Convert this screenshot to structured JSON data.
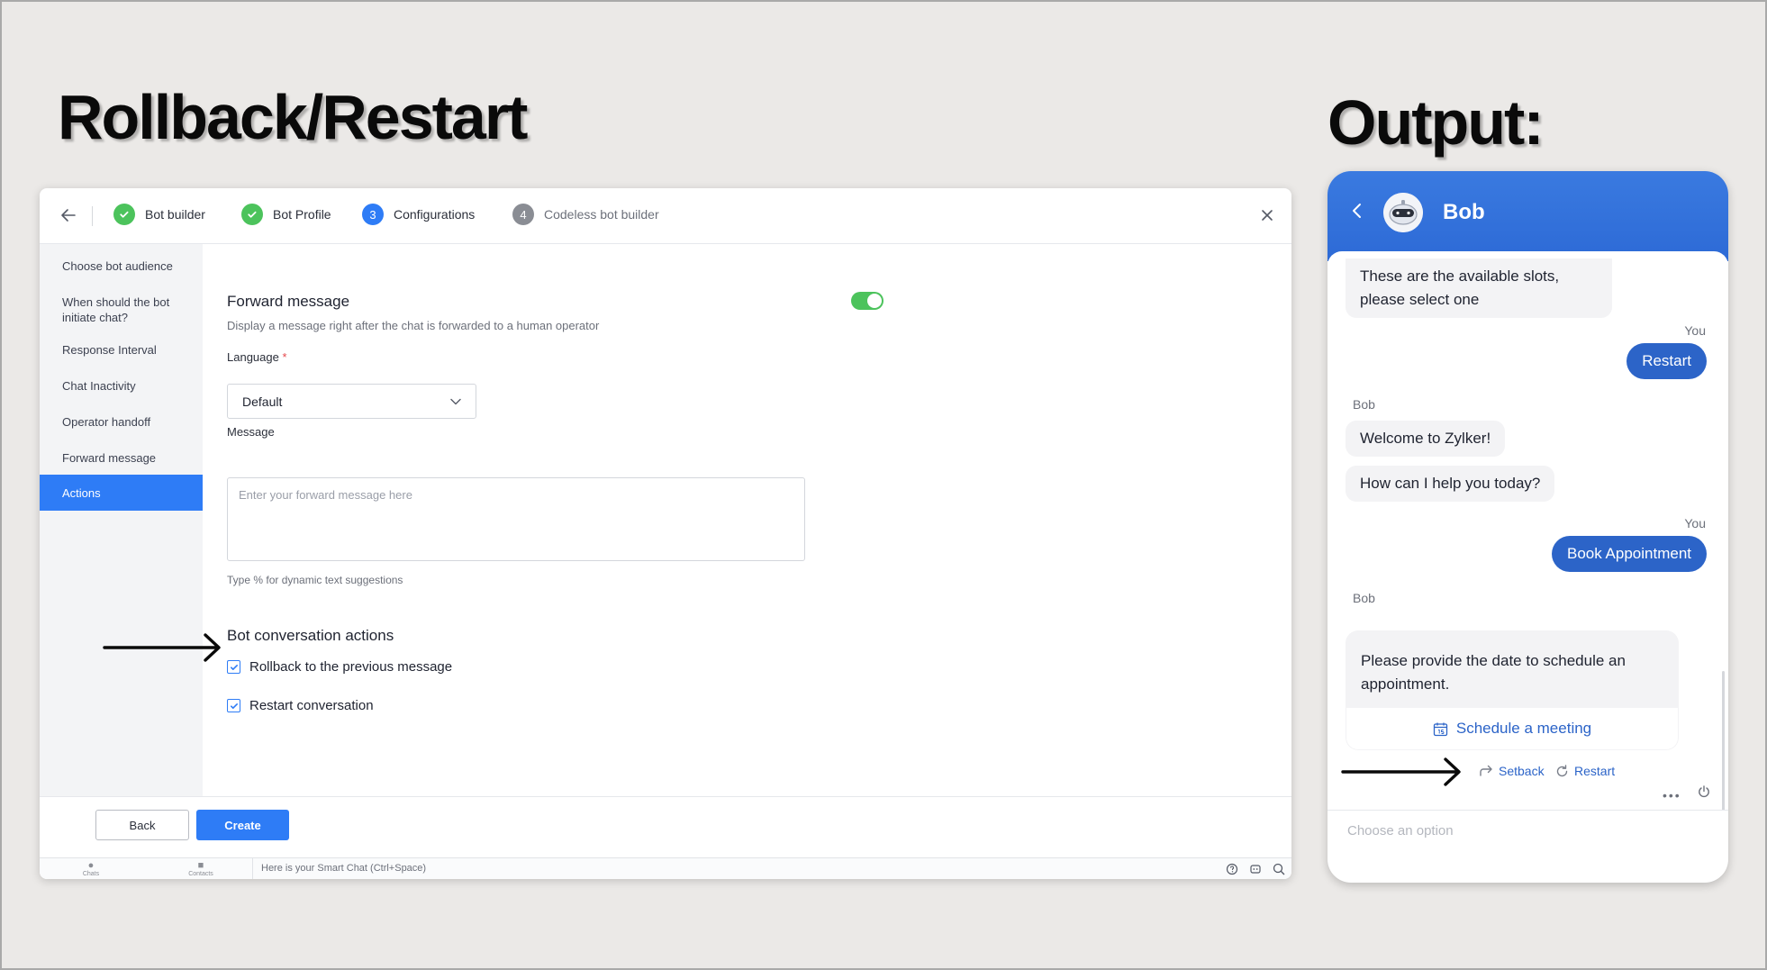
{
  "headings": {
    "left": "Rollback/Restart",
    "right": "Output:"
  },
  "topbar": {
    "steps": [
      {
        "label": "Bot builder",
        "state": "done"
      },
      {
        "label": "Bot Profile",
        "state": "done"
      },
      {
        "label": "Configurations",
        "number": "3",
        "state": "active"
      },
      {
        "label": "Codeless bot builder",
        "number": "4",
        "state": "todo"
      }
    ]
  },
  "sidebar": {
    "items": [
      {
        "label": "Choose bot audience"
      },
      {
        "label": "When should the bot initiate chat?"
      },
      {
        "label": "Response Interval"
      },
      {
        "label": "Chat Inactivity"
      },
      {
        "label": "Operator handoff"
      },
      {
        "label": "Forward message"
      },
      {
        "label": "Actions",
        "active": true
      }
    ]
  },
  "forward_message": {
    "title": "Forward message",
    "description": "Display a message right after the chat is forwarded to a human operator",
    "enabled": true,
    "language_label": "Language",
    "required_mark": "*",
    "language_value": "Default",
    "message_label": "Message",
    "message_placeholder": "Enter your forward message here",
    "hint": "Type % for dynamic text suggestions"
  },
  "bot_actions": {
    "title": "Bot conversation actions",
    "options": [
      {
        "label": "Rollback to the previous message",
        "checked": true
      },
      {
        "label": "Restart conversation",
        "checked": true
      }
    ]
  },
  "footer": {
    "back_label": "Back",
    "create_label": "Create"
  },
  "statusbar": {
    "tabs": [
      {
        "label": "Chats",
        "icon": "chat-bubbles-icon"
      },
      {
        "label": "Contacts",
        "icon": "contacts-icon"
      }
    ],
    "smart_chat_placeholder": "Here is your Smart Chat (Ctrl+Space)"
  },
  "widget": {
    "bot_name": "Bob",
    "messages": [
      {
        "from": "bot",
        "text": "These are the available slots, please select one"
      },
      {
        "from": "user",
        "sender": "You",
        "text": "Restart"
      },
      {
        "from": "bot",
        "sender": "Bob",
        "text": "Welcome to Zylker!"
      },
      {
        "from": "bot",
        "text": "How can I help you today?"
      },
      {
        "from": "user",
        "sender": "You",
        "text": "Book Appointment"
      },
      {
        "from": "bot",
        "sender": "Bob",
        "text": "Please provide the date to schedule an appointment."
      }
    ],
    "card_action": "Schedule a meeting",
    "quick_actions": [
      {
        "label": "Setback"
      },
      {
        "label": "Restart"
      }
    ],
    "more": "•••",
    "input_placeholder": "Choose an option"
  },
  "colors": {
    "accent": "#2e7cf6",
    "success": "#4cc35c",
    "widget_header": "#2d6ad6",
    "user_bubble": "#2c64c8"
  }
}
